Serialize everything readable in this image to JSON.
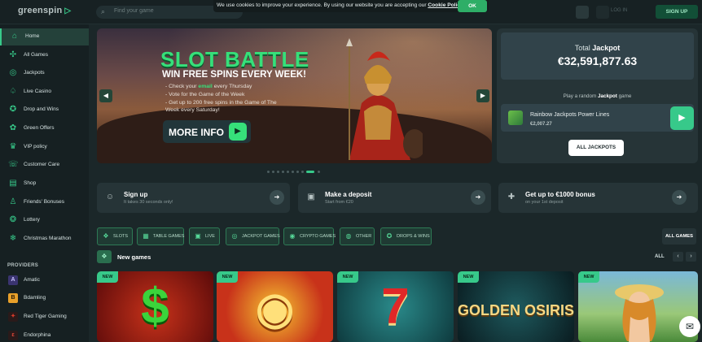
{
  "header": {
    "logo": "greenspin",
    "search_placeholder": "Find your game",
    "cookie_text": "We use cookies to improve your experience. By using our website you are accepting our ",
    "cookie_link": "Cookie Policy",
    "cookie_ok": "OK",
    "login_label": "LOG IN",
    "signup": "SIGN UP"
  },
  "sidebar": {
    "items": [
      {
        "label": "Home",
        "icon": "home-icon",
        "glyph": "⌂",
        "active": true
      },
      {
        "label": "All Games",
        "icon": "games-icon",
        "glyph": "✣"
      },
      {
        "label": "Jackpots",
        "icon": "jackpot-icon",
        "glyph": "◎"
      },
      {
        "label": "Live Casino",
        "icon": "live-casino-icon",
        "glyph": "♤"
      },
      {
        "label": "Drop and Wins",
        "icon": "drop-wins-icon",
        "glyph": "✪"
      },
      {
        "label": "Green Offers",
        "icon": "offers-icon",
        "glyph": "✿"
      },
      {
        "label": "VIP policy",
        "icon": "vip-icon",
        "glyph": "♛"
      },
      {
        "label": "Customer Care",
        "icon": "customer-care-icon",
        "glyph": "☏"
      },
      {
        "label": "Shop",
        "icon": "shop-icon",
        "glyph": "▤"
      },
      {
        "label": "Friends' Bonuses",
        "icon": "friends-icon",
        "glyph": "♙"
      },
      {
        "label": "Lottery",
        "icon": "lottery-icon",
        "glyph": "❂"
      },
      {
        "label": "Christmas Marathon",
        "icon": "christmas-icon",
        "glyph": "❄"
      }
    ],
    "providers_title": "PROVIDERS",
    "providers": [
      {
        "label": "Amatic",
        "icon": "amatic-icon",
        "glyph": "A",
        "color": "#6a5acd"
      },
      {
        "label": "Bdamling",
        "icon": "bdamling-icon",
        "glyph": "B",
        "color": "#e8a02a"
      },
      {
        "label": "Red Tiger Gaming",
        "icon": "red-tiger-icon",
        "glyph": "✦",
        "color": "#d83a2a"
      },
      {
        "label": "Endorphina",
        "icon": "endorphina-icon",
        "glyph": "ε",
        "color": "#d83a2a"
      }
    ]
  },
  "banner": {
    "title": "SLOT BATTLE",
    "subtitle": "WIN FREE SPINS EVERY WEEK!",
    "line1_pre": "- Check your ",
    "line1_hl": "email",
    "line1_post": " every Thursday",
    "line2": "- Vote for the Game of the Week",
    "line3": "- Get up to 200 free spins in the Game of The",
    "line4": "Week every Saturday!",
    "cta": "MORE INFO"
  },
  "jackpot": {
    "label_pre": "Total ",
    "label_bold": "Jackpot",
    "amount": "€32,591,877.63",
    "random_pre": "Play a random ",
    "random_bold": "Jackpot",
    "random_post": " game",
    "game_name": "Rainbow Jackpots Power Lines",
    "game_value": "€2,007.27",
    "all_button": "ALL JACKPOTS"
  },
  "promos": [
    {
      "title": "Sign up",
      "sub": "It takes 30 seconds only!",
      "icon": "user-icon",
      "glyph": "☺"
    },
    {
      "title": "Make a deposit",
      "sub": "Start from €20",
      "icon": "wallet-icon",
      "glyph": "▣"
    },
    {
      "title": "Get up to €1000 bonus",
      "sub": "on your 1st deposit",
      "icon": "gift-icon",
      "glyph": "✚"
    }
  ],
  "categories": [
    {
      "label": "SLOTS",
      "icon": "slots-icon",
      "glyph": "❖"
    },
    {
      "label": "TABLE GAMES",
      "icon": "table-games-icon",
      "glyph": "▦"
    },
    {
      "label": "LIVE",
      "icon": "live-icon",
      "glyph": "▣"
    },
    {
      "label": "JACKPOT GAMES",
      "icon": "jackpot-games-icon",
      "glyph": "◎"
    },
    {
      "label": "CRYPTO GAMES",
      "icon": "crypto-icon",
      "glyph": "◉"
    },
    {
      "label": "OTHER",
      "icon": "other-icon",
      "glyph": "◍"
    },
    {
      "label": "DROPS & WINS",
      "icon": "drops-icon",
      "glyph": "✪"
    }
  ],
  "all_games": "ALL GAMES",
  "new_games": {
    "title": "New games",
    "all": "ALL",
    "badge": "NEW",
    "cards": [
      {
        "glyph": "$",
        "name": "",
        "bg": "#7a1414",
        "color": "#3bd43b"
      },
      {
        "glyph": "◉",
        "name": "",
        "bg": "#c8321a",
        "color": "#f6c431"
      },
      {
        "glyph": "7",
        "name": "",
        "bg": "#1b6a6a",
        "color": "#e02828"
      },
      {
        "glyph": "",
        "name": "GOLDEN OSIRIS",
        "bg": "#123a3e",
        "color": "#f5d884"
      },
      {
        "glyph": "",
        "name": "",
        "bg": "#7ab8d8",
        "color": "#ffffff"
      }
    ]
  }
}
